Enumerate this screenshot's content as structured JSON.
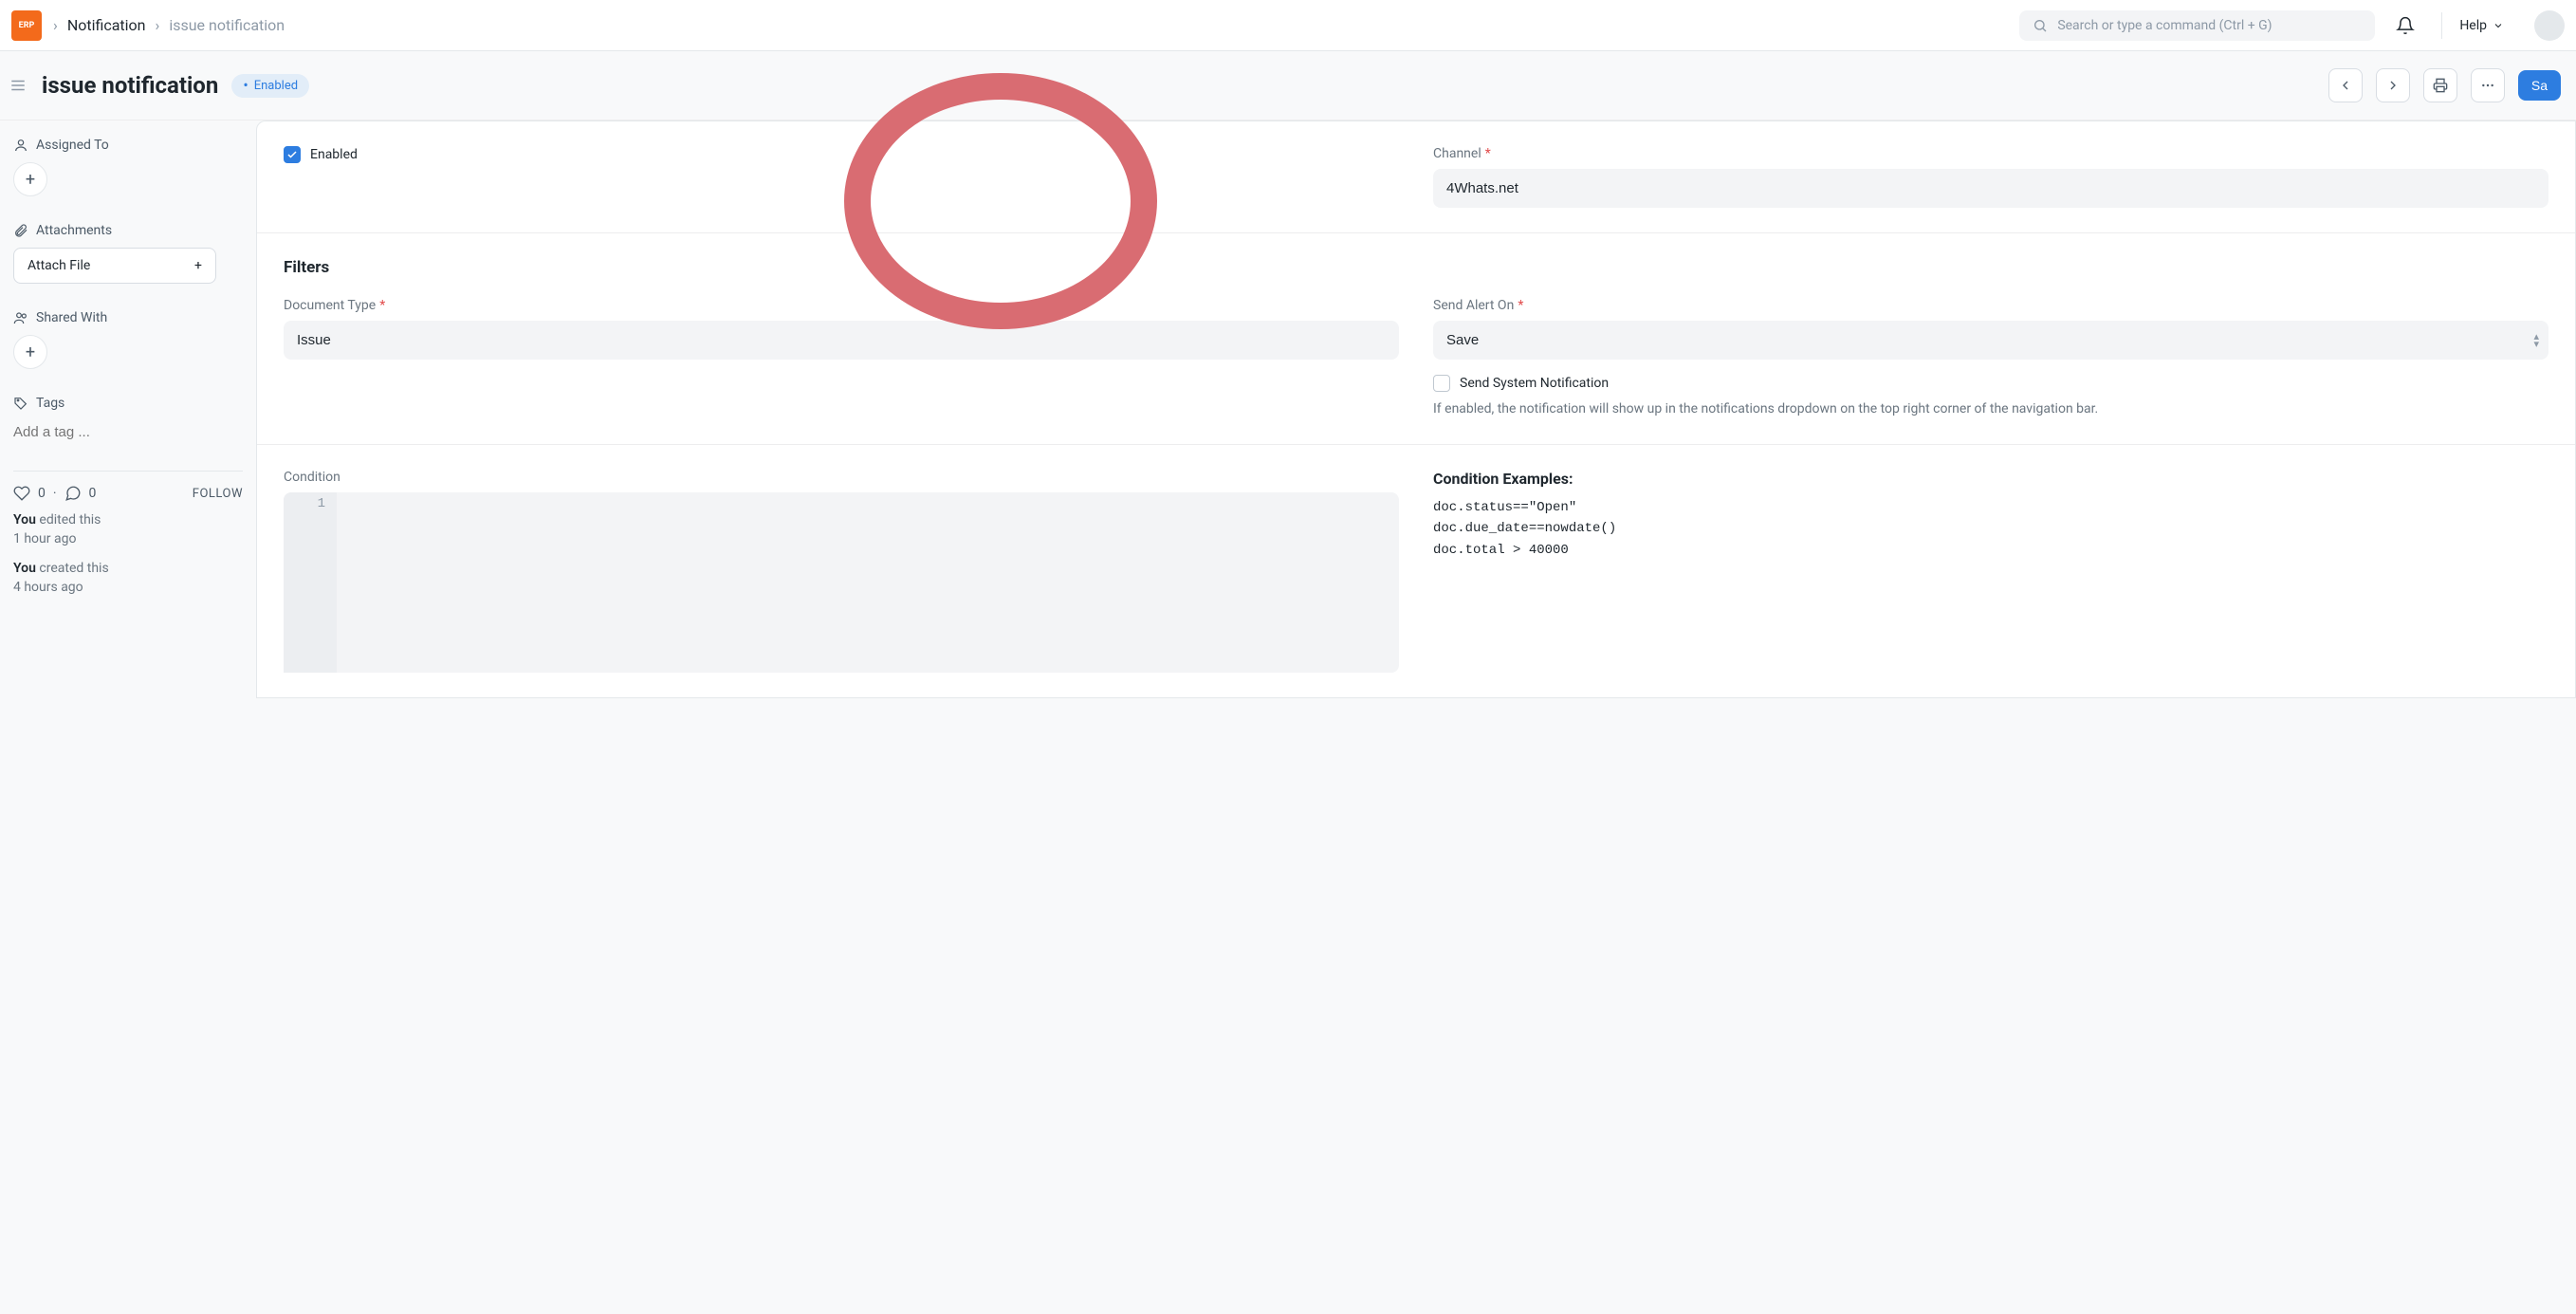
{
  "nav": {
    "breadcrumb_parent": "Notification",
    "breadcrumb_current": "issue notification",
    "search_placeholder": "Search or type a command (Ctrl + G)",
    "help_label": "Help"
  },
  "header": {
    "title": "issue notification",
    "status": "Enabled",
    "save_label": "Sa"
  },
  "sidebar": {
    "assigned_to_label": "Assigned To",
    "attachments_label": "Attachments",
    "attach_file_label": "Attach File",
    "shared_with_label": "Shared With",
    "tags_label": "Tags",
    "tags_placeholder": "Add a tag ...",
    "like_count": "0",
    "comment_count": "0",
    "follow_label": "FOLLOW",
    "log": [
      {
        "who": "You",
        "action": "edited this",
        "when": "1 hour ago"
      },
      {
        "who": "You",
        "action": "created this",
        "when": "4 hours ago"
      }
    ]
  },
  "form": {
    "enabled_label": "Enabled",
    "enabled_checked": true,
    "channel_label": "Channel",
    "channel_value": "4Whats.net",
    "filters_title": "Filters",
    "doctype_label": "Document Type",
    "doctype_value": "Issue",
    "send_alert_label": "Send Alert On",
    "send_alert_value": "Save",
    "send_system_label": "Send System Notification",
    "send_system_help": "If enabled, the notification will show up in the notifications dropdown on the top right corner of the navigation bar.",
    "condition_label": "Condition",
    "condition_line_no": "1",
    "examples_title": "Condition Examples:",
    "examples_code": "doc.status==\"Open\"\ndoc.due_date==nowdate()\ndoc.total > 40000"
  }
}
